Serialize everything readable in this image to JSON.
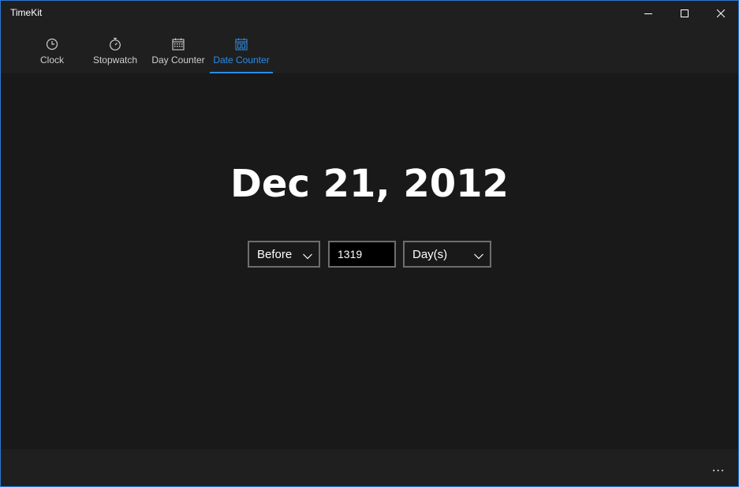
{
  "window": {
    "title": "TimeKit",
    "accent_color": "#2b8ce6"
  },
  "caption_buttons": {
    "minimize_icon": "minimize-icon",
    "maximize_icon": "maximize-icon",
    "close_icon": "close-icon"
  },
  "nav": {
    "items": [
      {
        "label": "Clock",
        "icon": "clock-icon",
        "active": false
      },
      {
        "label": "Stopwatch",
        "icon": "stopwatch-icon",
        "active": false
      },
      {
        "label": "Day Counter",
        "icon": "calendar-icon",
        "active": false
      },
      {
        "label": "Date Counter",
        "icon": "calendar-grid-icon",
        "active": true
      }
    ]
  },
  "main": {
    "result_date": "Dec 21, 2012",
    "direction": {
      "selected": "Before"
    },
    "amount": {
      "value": "1319"
    },
    "unit": {
      "selected": "Day(s)"
    }
  },
  "bottom_bar": {
    "more_label": "..."
  }
}
